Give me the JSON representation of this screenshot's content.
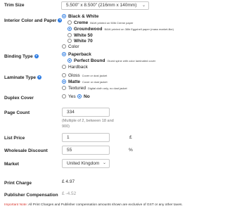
{
  "trim_size": {
    "label": "Trim Size",
    "value": "5.500\" x 8.500\" (216mm x 140mm)"
  },
  "interior": {
    "label": "Interior Color and Paper",
    "options": [
      {
        "label": "Black & White"
      },
      {
        "label": "Creme",
        "note": "B&W printed on 50lb Creme paper"
      },
      {
        "label": "Groundwood",
        "note": "B&W printed on 38lb Eggshell paper (mass market-like)"
      },
      {
        "label": "White 50"
      },
      {
        "label": "White 70"
      },
      {
        "label": "Color"
      }
    ]
  },
  "binding": {
    "label": "Binding Type",
    "options": [
      {
        "label": "Paperback"
      },
      {
        "label": "Perfect Bound",
        "note": "Glued spine with color laminated cover"
      },
      {
        "label": "Hardback"
      }
    ]
  },
  "laminate": {
    "label": "Laminate Type",
    "options": [
      {
        "label": "Gloss",
        "note": "Cover or dust jacket"
      },
      {
        "label": "Matte",
        "note": "Cover or dust jacket"
      },
      {
        "label": "Textured",
        "note": "Digital cloth only, no dust jacket"
      }
    ]
  },
  "duplex": {
    "label": "Duplex Cover",
    "yes": "Yes",
    "no": "No"
  },
  "page_count": {
    "label": "Page Count",
    "value": "334",
    "hint": "(Multiple of 2, between 18 and 900)"
  },
  "list_price": {
    "label": "List Price",
    "value": "1",
    "unit": "£"
  },
  "wholesale": {
    "label": "Wholesale Discount",
    "value": "55",
    "unit": "%"
  },
  "market": {
    "label": "Market",
    "value": "United Kingdom"
  },
  "print_charge": {
    "label": "Print Charge",
    "value": "£  4.97"
  },
  "publisher_comp": {
    "label": "Publisher Compensation",
    "value": "£  -4.52"
  },
  "footer": {
    "important": "Important Note:",
    "text": " All Print Charges and Publisher compensation amounts shown are exclusive of GST or any other taxes."
  }
}
